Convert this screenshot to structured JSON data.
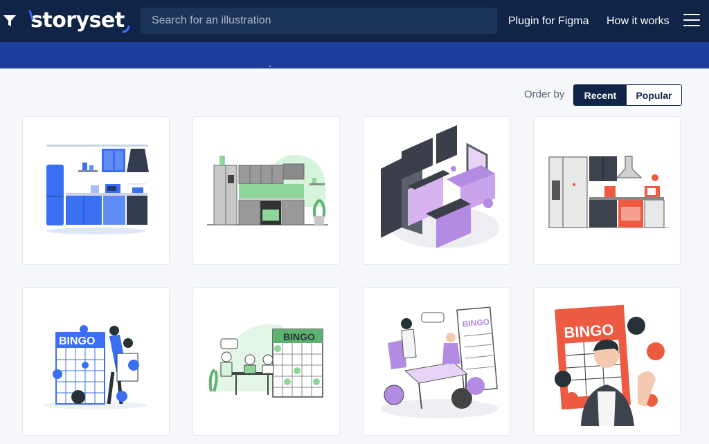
{
  "header": {
    "logo_text": "storyset",
    "search_placeholder": "Search for an illustration",
    "nav": [
      "Plugin for Figma",
      "How it works"
    ]
  },
  "order": {
    "label": "Order by",
    "options": [
      "Recent",
      "Popular"
    ],
    "selected": "Recent"
  },
  "colors": {
    "navbar": "#0f2446",
    "band": "#1c3f9e",
    "accent_blue": "#3b6ff2",
    "accent_green": "#8ed69a",
    "accent_purple": "#b48be3",
    "accent_red": "#ec5a42"
  },
  "cards": [
    {
      "name": "kitchen-blue-illustration",
      "accent": "#3b6ff2"
    },
    {
      "name": "kitchen-green-illustration",
      "accent": "#8ed69a"
    },
    {
      "name": "kitchen-purple-isometric-illustration",
      "accent": "#b48be3"
    },
    {
      "name": "kitchen-red-illustration",
      "accent": "#ec5a42"
    },
    {
      "name": "bingo-blue-illustration",
      "accent": "#3b6ff2",
      "text": "BINGO"
    },
    {
      "name": "bingo-green-illustration",
      "accent": "#8ed69a",
      "text": "BINGO"
    },
    {
      "name": "bingo-purple-illustration",
      "accent": "#b48be3",
      "text": "BINGO!"
    },
    {
      "name": "bingo-red-illustration",
      "accent": "#ec5a42",
      "text": "BINGO"
    }
  ]
}
